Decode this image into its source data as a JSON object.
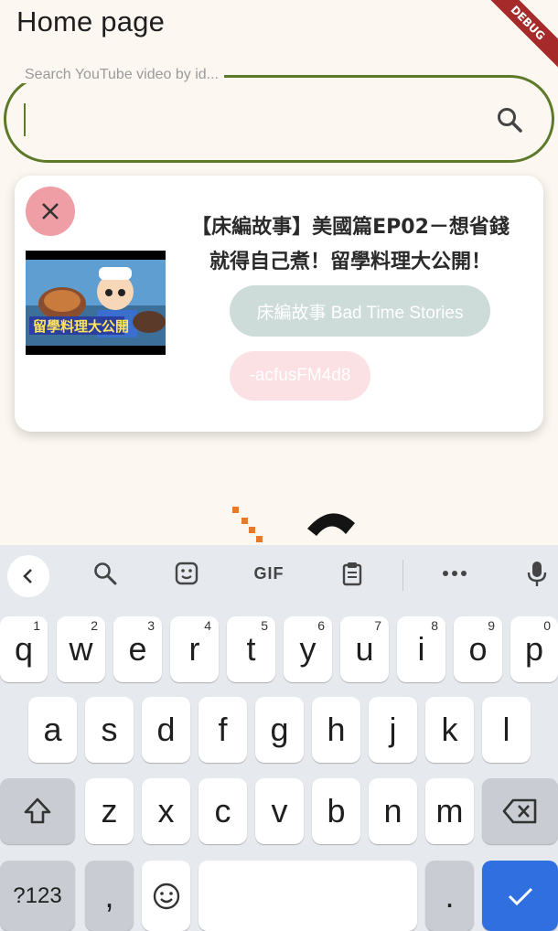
{
  "app": {
    "title": "Home page",
    "debug_label": "DEBUG"
  },
  "search": {
    "label": "Search YouTube video by id...",
    "value": "",
    "icon": "search-icon"
  },
  "video_card": {
    "title": "【床編故事】美國篇EP02－想省錢就得自己煮！留學料理大公開！",
    "channel": "床編故事 Bad Time Stories",
    "video_id": "-acfusFM4d8",
    "thumbnail_caption": "留學料理大公開"
  },
  "keyboard": {
    "toolbar": [
      "back-icon",
      "search-icon",
      "sticker-icon",
      "GIF",
      "clipboard-icon",
      "more-icon",
      "mic-icon"
    ],
    "row1": [
      {
        "k": "q",
        "n": "1"
      },
      {
        "k": "w",
        "n": "2"
      },
      {
        "k": "e",
        "n": "3"
      },
      {
        "k": "r",
        "n": "4"
      },
      {
        "k": "t",
        "n": "5"
      },
      {
        "k": "y",
        "n": "6"
      },
      {
        "k": "u",
        "n": "7"
      },
      {
        "k": "i",
        "n": "8"
      },
      {
        "k": "o",
        "n": "9"
      },
      {
        "k": "p",
        "n": "0"
      }
    ],
    "row2": [
      "a",
      "s",
      "d",
      "f",
      "g",
      "h",
      "j",
      "k",
      "l"
    ],
    "row3": [
      "z",
      "x",
      "c",
      "v",
      "b",
      "n",
      "m"
    ],
    "row4": {
      "symbols": "?123",
      "comma": ",",
      "period": "."
    }
  },
  "colors": {
    "background": "#fcf8f1",
    "search_border": "#5d7a2b",
    "close_button": "#ef9ea5",
    "channel_chip": "#cddcd9",
    "id_chip": "#fbe0e4",
    "enter_key": "#2f6fe0",
    "debug_banner": "#a72a2a"
  }
}
